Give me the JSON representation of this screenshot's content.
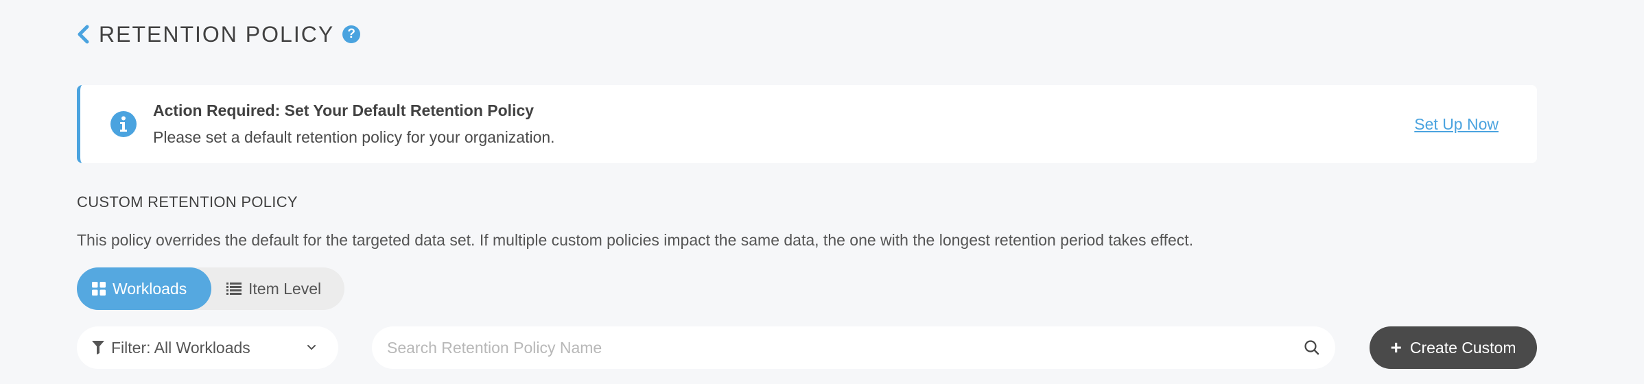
{
  "header": {
    "title": "RETENTION POLICY",
    "help_icon": "?"
  },
  "alert": {
    "title": "Action Required: Set Your Default Retention Policy",
    "message": "Please set a default retention policy for your organization.",
    "link": "Set Up Now"
  },
  "custom_policy": {
    "title": "CUSTOM RETENTION POLICY",
    "description": "This policy overrides the default for the targeted data set. If multiple custom policies impact the same data, the one with the longest retention period takes effect.",
    "tabs": [
      {
        "label": "Workloads",
        "icon": "grid-icon",
        "active": true
      },
      {
        "label": "Item Level",
        "icon": "list-icon",
        "active": false
      }
    ]
  },
  "toolbar": {
    "filter_label": "Filter: All Workloads",
    "search_placeholder": "Search Retention Policy Name",
    "search_value": "",
    "create_label": "Create Custom"
  },
  "colors": {
    "accent": "#4aa3df",
    "dark_button": "#4a4a4a",
    "background": "#f6f7f9"
  }
}
